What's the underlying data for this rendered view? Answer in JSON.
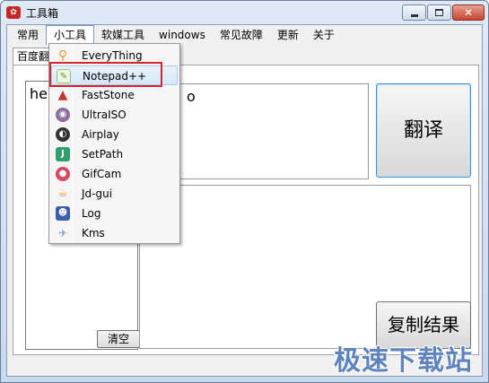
{
  "window": {
    "title": "工具箱",
    "close_glyph": "✕"
  },
  "menubar": {
    "items": [
      "常用",
      "小工具",
      "软媒工具",
      "windows",
      "常见故障",
      "更新",
      "关于"
    ],
    "active_index": 1
  },
  "tabs": [
    {
      "label": "百度翻"
    }
  ],
  "input": {
    "value": "hel"
  },
  "output": {
    "value": "o"
  },
  "buttons": {
    "clear": "清空",
    "translate": "翻译",
    "copy": "复制结果"
  },
  "dropdown": {
    "items": [
      {
        "label": "EveryThing",
        "icon": "magnifier-icon",
        "color": "#e0a030"
      },
      {
        "label": "Notepad++",
        "icon": "notepad-chameleon-icon",
        "color": "#5a9a3a"
      },
      {
        "label": "FastStone",
        "icon": "faststone-icon",
        "color": "#c0392b"
      },
      {
        "label": "UltraISO",
        "icon": "disc-icon",
        "color": "#8a6d9c"
      },
      {
        "label": "Airplay",
        "icon": "airplay-icon",
        "color": "#333333"
      },
      {
        "label": "SetPath",
        "icon": "setpath-icon",
        "color": "#2e9e6a"
      },
      {
        "label": "GifCam",
        "icon": "camera-icon",
        "color": "#d84860"
      },
      {
        "label": "Jd-gui",
        "icon": "coffee-cup-icon",
        "color": "#e6a23c"
      },
      {
        "label": "Log",
        "icon": "users-icon",
        "color": "#3b5ea8"
      },
      {
        "label": "Kms",
        "icon": "key-icon",
        "color": "#7aa0c8"
      }
    ],
    "hover_index": 1
  },
  "watermark": "极速下载站",
  "colors": {
    "highlight": "#d3262e",
    "accent": "#3a8fd6"
  }
}
